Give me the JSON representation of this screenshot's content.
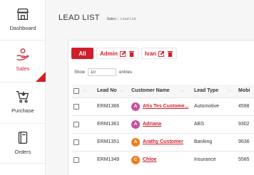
{
  "sidebar": {
    "items": [
      {
        "label": "Dashboard",
        "icon": "store-icon",
        "active": false
      },
      {
        "label": "Sales",
        "icon": "sales-hand-icon",
        "active": true
      },
      {
        "label": "Purchase",
        "icon": "cart-icon",
        "active": false
      },
      {
        "label": "Orders",
        "icon": "book-icon",
        "active": false
      }
    ]
  },
  "header": {
    "title": "LEAD LIST",
    "breadcrumb": [
      "Sales",
      "Lead List"
    ]
  },
  "filters": {
    "all_label": "All",
    "chips": [
      {
        "label": "Admin"
      },
      {
        "label": "Ivan"
      }
    ]
  },
  "show_entries": {
    "prefix": "Show",
    "value": "10",
    "suffix": "entries"
  },
  "table": {
    "sort_glyph": "↑↓",
    "columns": [
      "Lead No",
      "Customer Name",
      "Lead Type",
      "Mobi"
    ],
    "rows": [
      {
        "lead_no": "ERM1366",
        "initial": "A",
        "avatar_color": "#c94f9e",
        "customer": "Atis Tes Custome...",
        "lead_type": "Automotive",
        "mobile": "4598"
      },
      {
        "lead_no": "ERM1361",
        "initial": "A",
        "avatar_color": "#c94f9e",
        "customer": "Adriana",
        "lead_type": "ABS",
        "mobile": "9302"
      },
      {
        "lead_no": "ERM1351",
        "initial": "A",
        "avatar_color": "#ef7c1e",
        "customer": "Arathy Customer",
        "lead_type": "Banking",
        "mobile": "9636"
      },
      {
        "lead_no": "ERM1349",
        "initial": "C",
        "avatar_color": "#ef7c1e",
        "customer": "Chloe",
        "lead_type": "Insurance",
        "mobile": "5585"
      }
    ]
  },
  "colors": {
    "accent": "#d01f2c",
    "avatar_pink": "#c94f9e",
    "avatar_orange": "#ef7c1e"
  }
}
